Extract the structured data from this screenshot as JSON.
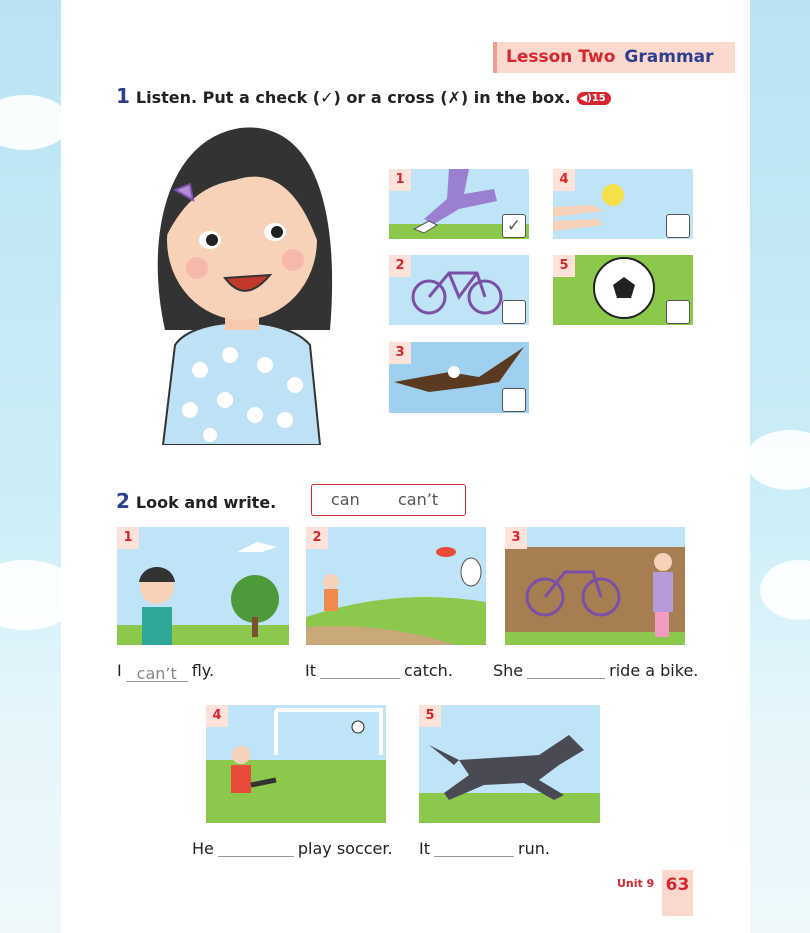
{
  "header": {
    "lesson": "Lesson Two",
    "section": "Grammar"
  },
  "exercise1": {
    "number": "1",
    "instruction": "Listen. Put a check (✓) or a cross (✗) in the box.",
    "audio_track": "15",
    "items": [
      {
        "number": "1",
        "subject": "running legs",
        "box": "✓"
      },
      {
        "number": "2",
        "subject": "bicycle",
        "box": ""
      },
      {
        "number": "3",
        "subject": "eagle",
        "box": ""
      },
      {
        "number": "4",
        "subject": "catching ball",
        "box": ""
      },
      {
        "number": "5",
        "subject": "soccer ball",
        "box": ""
      }
    ]
  },
  "exercise2": {
    "number": "2",
    "instruction": "Look and write.",
    "words": [
      "can",
      "can’t"
    ],
    "items": [
      {
        "number": "1",
        "before": "I",
        "answer": "can’t",
        "after": "fly."
      },
      {
        "number": "2",
        "before": "It",
        "answer": "",
        "after": "catch."
      },
      {
        "number": "3",
        "before": "She",
        "answer": "",
        "after": "ride a bike."
      },
      {
        "number": "4",
        "before": "He",
        "answer": "",
        "after": "play soccer."
      },
      {
        "number": "5",
        "before": "It",
        "answer": "",
        "after": "run."
      }
    ]
  },
  "footer": {
    "unit": "Unit 9",
    "page": "63"
  },
  "colors": {
    "accent_red": "#d6262e",
    "accent_blue": "#2c3f8f",
    "tag_pink": "#fbd9cf"
  }
}
